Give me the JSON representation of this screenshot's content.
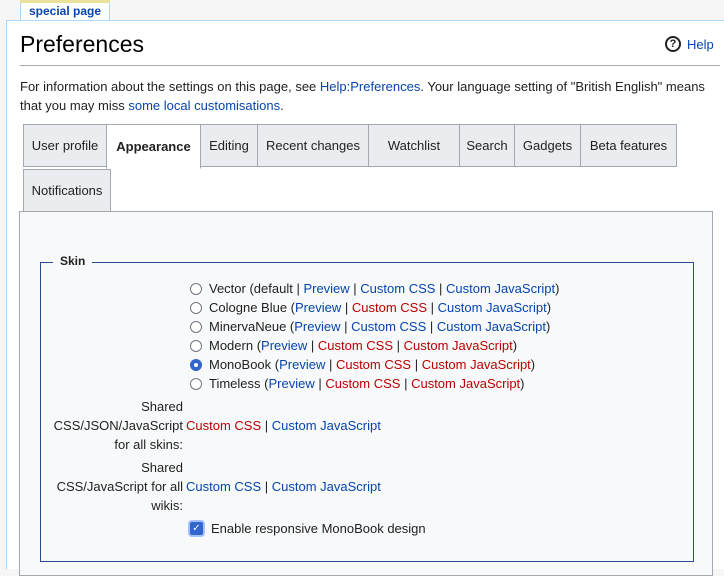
{
  "page_tab": "special page",
  "title": "Preferences",
  "help_label": "Help",
  "intro": {
    "pre": "For information about the settings on this page, see ",
    "help_link": "Help:Preferences",
    "mid": ". Your language setting of \"British English\" means that you may miss ",
    "local_link": "some local customisations",
    "post": "."
  },
  "tabs": [
    "User profile",
    "Appearance",
    "Editing",
    "Recent changes",
    "Watchlist",
    "Search",
    "Gadgets",
    "Beta features",
    "Notifications"
  ],
  "active_tab": "Appearance",
  "skin": {
    "legend": "Skin",
    "options": [
      {
        "name": "Vector (default",
        "preview": "Preview",
        "css": "Custom CSS",
        "js": "Custom JavaScript",
        "selected": false
      },
      {
        "name": "Cologne Blue (",
        "preview": "Preview",
        "css": "Custom CSS",
        "js": "Custom JavaScript",
        "selected": false
      },
      {
        "name": "MinervaNeue (",
        "preview": "Preview",
        "css": "Custom CSS",
        "js": "Custom JavaScript",
        "selected": false
      },
      {
        "name": "Modern (",
        "preview": "Preview",
        "css": "Custom CSS",
        "js": "Custom JavaScript",
        "selected": false
      },
      {
        "name": "MonoBook (",
        "preview": "Preview",
        "css": "Custom CSS",
        "js": "Custom JavaScript",
        "selected": true
      },
      {
        "name": "Timeless (",
        "preview": "Preview",
        "css": "Custom CSS",
        "js": "Custom JavaScript",
        "selected": false
      }
    ],
    "shared_all_skins": {
      "label_l1": "Shared",
      "label_l2": "CSS/JSON/JavaScript",
      "label_l3": "for all skins:",
      "css": "Custom CSS",
      "js": "Custom JavaScript"
    },
    "shared_all_wikis": {
      "label_l1": "Shared",
      "label_l2": "CSS/JavaScript for all",
      "label_l3": "wikis:",
      "css": "Custom CSS",
      "js": "Custom JavaScript"
    },
    "responsive_label": "Enable responsive MonoBook design",
    "responsive_checked": true
  },
  "colors": {
    "link": "#0645ad",
    "new_link": "#ba0000",
    "accent": "#3366cc"
  }
}
